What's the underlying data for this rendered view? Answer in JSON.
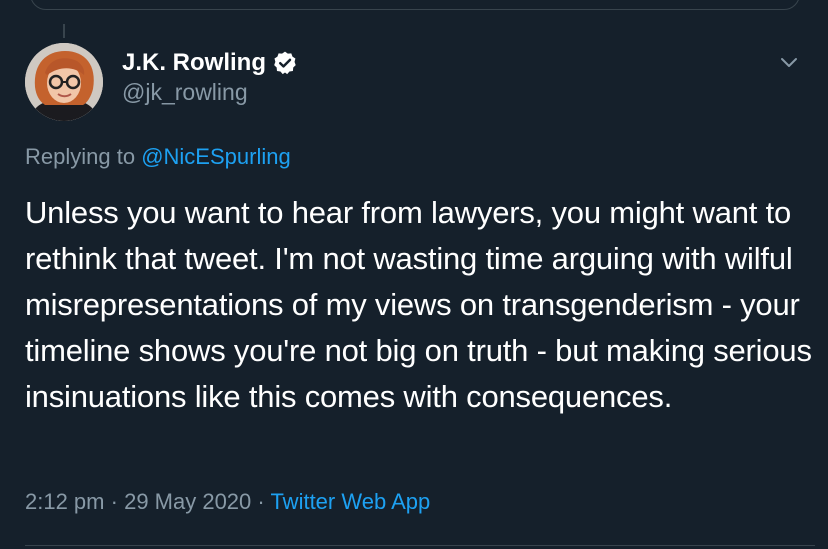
{
  "tweet": {
    "author": {
      "display_name": "J.K. Rowling",
      "handle": "@jk_rowling",
      "verified": true,
      "avatar_icon": "avatar-photo"
    },
    "replying_label": "Replying to",
    "replying_to": "@NicESpurling",
    "text": "Unless you want to hear from lawyers, you might want to rethink that tweet. I'm not wasting time arguing with wilful misrepresentations of my views on transgenderism - your timeline shows you're not big on truth - but making serious insinuations like this comes with consequences.",
    "time": "2:12 pm",
    "separator": "·",
    "date": "29 May 2020",
    "source": "Twitter Web App"
  },
  "icons": {
    "verified": "verified-badge-icon",
    "more": "chevron-down-icon"
  },
  "colors": {
    "background": "#15202b",
    "primary_text": "#ffffff",
    "secondary_text": "#8899a6",
    "accent": "#1da1f2",
    "border": "#38444d"
  }
}
